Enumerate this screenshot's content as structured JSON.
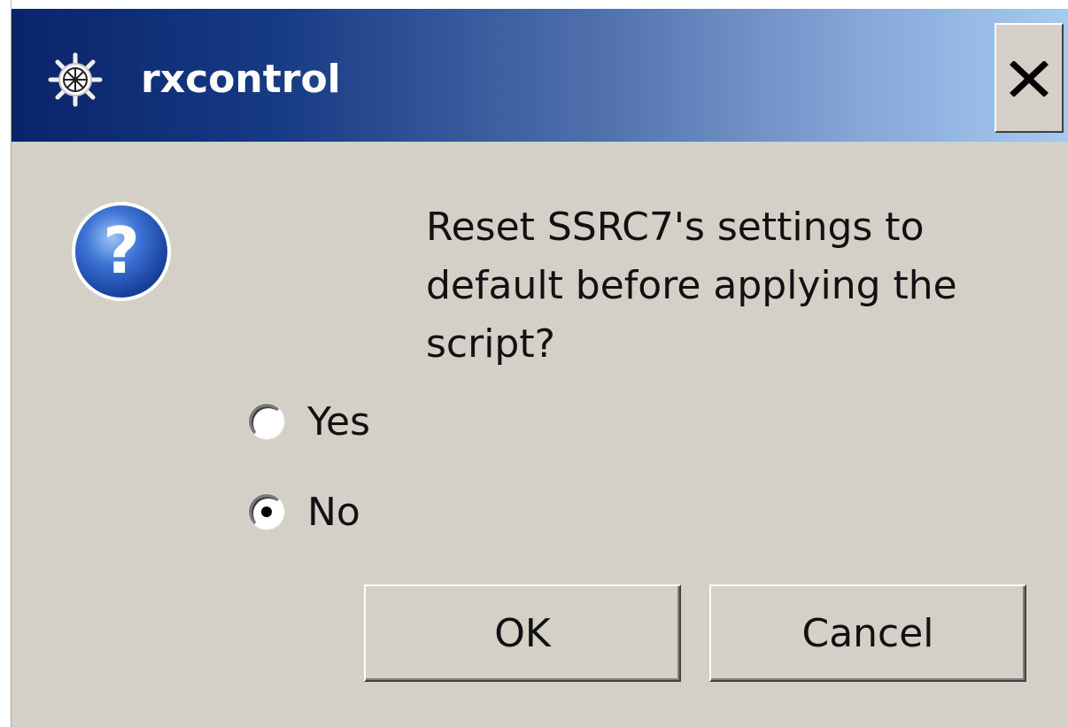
{
  "window": {
    "title": "rxcontrol",
    "app_icon": "helm-wheel-icon",
    "close_icon": "close-icon"
  },
  "dialog": {
    "icon": "question-icon",
    "message_lines": [
      "Reset SSRC7's settings to",
      "default before applying the",
      "script?"
    ]
  },
  "options": [
    {
      "label": "Yes",
      "selected": false
    },
    {
      "label": "No",
      "selected": true
    }
  ],
  "buttons": {
    "ok_label": "OK",
    "cancel_label": "Cancel"
  },
  "colors": {
    "titlebar_start": "#0a246a",
    "titlebar_end": "#a6caf0",
    "dialog_background": "#d4d0c8"
  }
}
